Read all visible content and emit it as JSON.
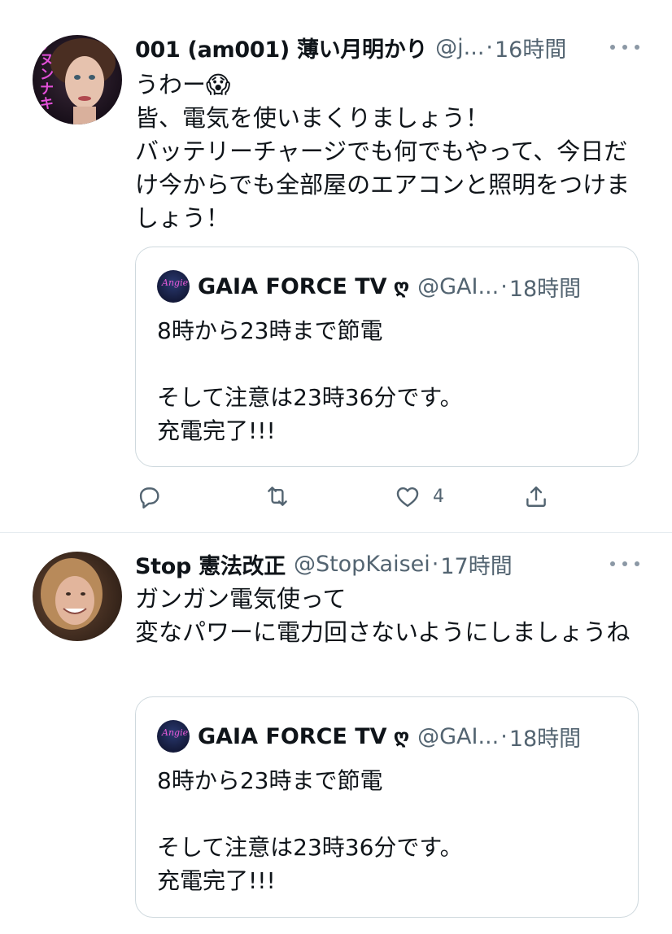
{
  "tweets": [
    {
      "name": "001 (am001) 薄い月明かり",
      "handle": "@j...",
      "dot": "·",
      "time": "16時間",
      "text": "うわー😱\n皆、電気を使いまくりましょう！\nバッテリーチャージでも何でもやって、今日だけ今からでも全部屋のエアコンと照明をつけましょう！",
      "avatar_text": "アヌンナキ",
      "quote": {
        "name": "GAIA FORCE TV",
        "mark": "ღ",
        "handle": "@GAI...",
        "dot": "·",
        "time": "18時間",
        "text": "8時から23時まで節電\n\nそして注意は23時36分です。\n充電完了!!!",
        "avatar_text": "Angie"
      },
      "actions": {
        "reply_count": "",
        "retweet_count": "",
        "like_count": "4"
      }
    },
    {
      "name": "Stop 憲法改正",
      "handle": "@StopKaisei",
      "dot": "·",
      "time": "17時間",
      "text": "ガンガン電気使って\n変なパワーに電力回さないようにしましょうね",
      "quote": {
        "name": "GAIA FORCE TV",
        "mark": "ღ",
        "handle": "@GAI...",
        "dot": "·",
        "time": "18時間",
        "text": "8時から23時まで節電\n\nそして注意は23時36分です。\n充電完了!!!",
        "avatar_text": "Angie"
      }
    }
  ],
  "colors": {
    "text": "#0f1419",
    "secondary": "#536471",
    "border": "#cfd9de",
    "divider": "#e6ecf0"
  },
  "icons": [
    "reply-icon",
    "retweet-icon",
    "like-icon",
    "share-icon",
    "more-icon"
  ]
}
